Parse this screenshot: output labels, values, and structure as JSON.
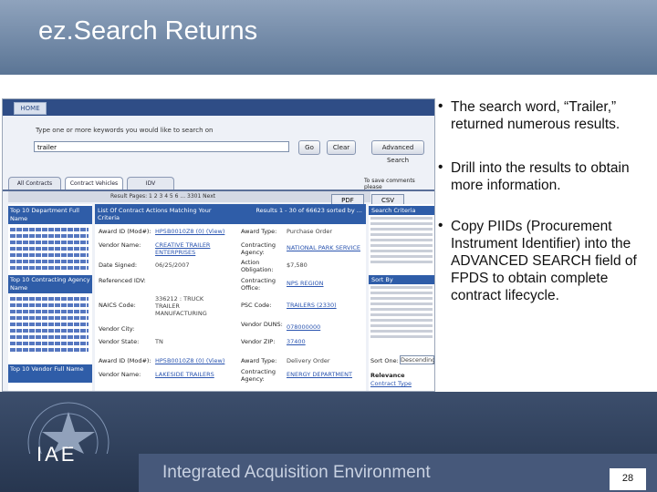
{
  "slide": {
    "title": "ez.Search Returns",
    "bullets": [
      "The search word, “Trailer,” returned numerous results.",
      "Drill into the results to obtain more information.",
      "Copy PIIDs (Procurement Instrument Identifier) into the ADVANCED SEARCH field of FPDS to obtain complete contract lifecycle."
    ],
    "footer_text": "Integrated Acquisition Environment",
    "logo_text": "IAE",
    "page_number": "28"
  },
  "screenshot": {
    "home_button": "HOME",
    "search_prompt": "Type one or more keywords you would like to search on",
    "search_value": "trailer",
    "go_button": "Go",
    "clear_button": "Clear",
    "advanced_button": "Advanced Search",
    "tabs": [
      "All Contracts",
      "Contract Vehicles",
      "IDV"
    ],
    "active_tab": "Contract Vehicles",
    "docs_text": "To save comments please",
    "pages_text": "Result Pages: 1 2 3 4 5 6 ... 3301 Next",
    "pdf_button": "PDF",
    "csv_button": "CSV",
    "left_sections": [
      "Top 10 Department Full Name",
      "Top 10 Contracting Agency Name",
      "Top 10 Vendor Full Name"
    ],
    "mid_header_left": "List Of Contract Actions Matching Your Criteria",
    "mid_header_right": "Results 1 - 30 of 66623 sorted by ...",
    "fields": [
      {
        "label": "Award ID (Mod#):",
        "value": "HP5B0010Z8 (0) (View)"
      },
      {
        "label": "Vendor Name:",
        "value": "CREATIVE TRAILER ENTERPRISES"
      },
      {
        "label": "Date Signed:",
        "value": "06/25/2007"
      },
      {
        "label": "Referenced IDV:",
        "value": ""
      },
      {
        "label": "NAICS Code:",
        "value": "336212 : TRUCK TRAILER MANUFACTURING"
      },
      {
        "label": "Vendor City:",
        "value": ""
      },
      {
        "label": "Vendor State:",
        "value": "TN"
      },
      {
        "label": "Award ID (Mod#):",
        "value": "HP5B0010Z8 (0) (View)"
      },
      {
        "label": "Vendor Name:",
        "value": "LAKESIDE TRAILERS"
      }
    ],
    "fields_right": [
      {
        "label": "Award Type:",
        "value": "Purchase Order"
      },
      {
        "label": "Contracting Agency:",
        "value": "NATIONAL PARK SERVICE"
      },
      {
        "label": "Action Obligation:",
        "value": "$7,580"
      },
      {
        "label": "Contracting Office:",
        "value": "NPS REGION"
      },
      {
        "label": "PSC Code:",
        "value": "TRAILERS (2330)"
      },
      {
        "label": "Vendor DUNS:",
        "value": "078000000"
      },
      {
        "label": "Vendor ZIP:",
        "value": "37400"
      },
      {
        "label": "Award Type:",
        "value": "Delivery Order"
      },
      {
        "label": "Contracting Agency:",
        "value": "ENERGY DEPARTMENT"
      }
    ],
    "right_sections": [
      "Search Criteria",
      "Sort By",
      "Relevance"
    ],
    "sort_label": "Sort One:",
    "sort_value": "Descending",
    "relevance_link": "Contract Type"
  }
}
